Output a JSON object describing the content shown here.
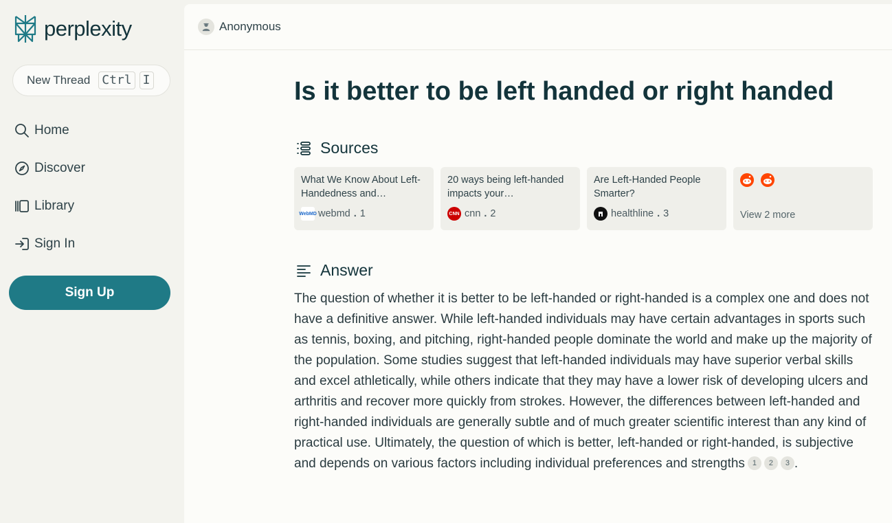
{
  "app": {
    "brand": "perplexity",
    "accent": "#1f7a86"
  },
  "sidebar": {
    "new_thread": {
      "label": "New Thread",
      "shortcut_1": "Ctrl",
      "shortcut_2": "I"
    },
    "nav": [
      {
        "label": "Home",
        "icon": "search-icon"
      },
      {
        "label": "Discover",
        "icon": "compass-icon"
      },
      {
        "label": "Library",
        "icon": "library-icon"
      },
      {
        "label": "Sign In",
        "icon": "sign-in-icon"
      }
    ],
    "signup_label": "Sign Up"
  },
  "topbar": {
    "user": "Anonymous"
  },
  "thread": {
    "title": "Is it better to be left handed or right handed",
    "sources_heading": "Sources",
    "sources": [
      {
        "title": "What We Know About Left-Handedness and…",
        "site": "webmd",
        "index": "1"
      },
      {
        "title": "20 ways being left-handed impacts your…",
        "site": "cnn",
        "index": "2"
      },
      {
        "title": "Are Left-Handed People Smarter?",
        "site": "healthline",
        "index": "3"
      }
    ],
    "more_sources": {
      "label": "View 2 more"
    },
    "answer_heading": "Answer",
    "answer_text": "The question of whether it is better to be left-handed or right-handed is a complex one and does not have a definitive answer. While left-handed individuals may have certain advantages in sports such as tennis, boxing, and pitching, right-handed people dominate the world and make up the majority of the population. Some studies suggest that left-handed individuals may have superior verbal skills and excel athletically, while others indicate that they may have a lower risk of developing ulcers and arthritis and recover more quickly from strokes. However, the differences between left-handed and right-handed individuals are generally subtle and of much greater scientific interest than any kind of practical use. Ultimately, the question of which is better, left-handed or right-handed, is subjective and depends on various factors including individual preferences and strengths",
    "citations": [
      "1",
      "2",
      "3"
    ],
    "answer_end": "."
  }
}
